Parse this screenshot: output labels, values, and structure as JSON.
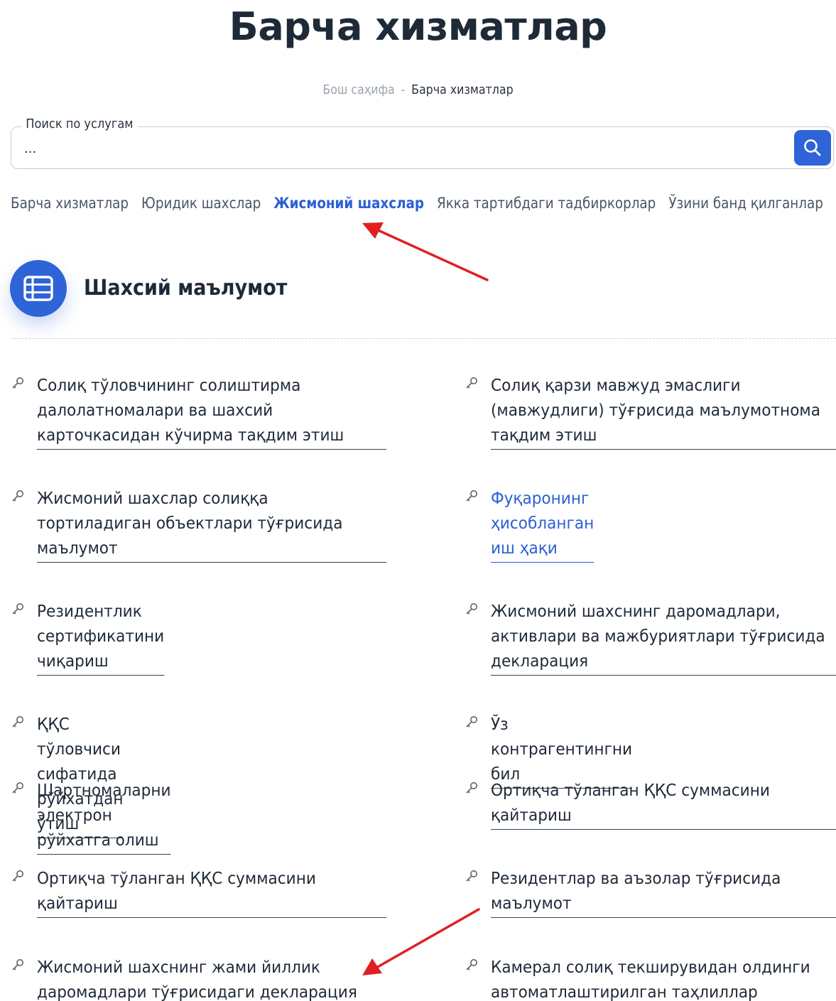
{
  "page": {
    "title": "Барча хизматлар"
  },
  "breadcrumb": {
    "home": "Бош саҳифа",
    "separator": "-",
    "current": "Барча хизматлар"
  },
  "search": {
    "label": "Поиск по услугам",
    "value": "",
    "placeholder": "...",
    "button_icon": "search-icon"
  },
  "tabs": [
    {
      "label": "Барча хизматлар",
      "active": false
    },
    {
      "label": "Юридик шахслар",
      "active": false
    },
    {
      "label": "Жисмоний шахслар",
      "active": true
    },
    {
      "label": "Якка тартибдаги тадбиркорлар",
      "active": false
    },
    {
      "label": "Ўзини банд қилганлар",
      "active": false
    }
  ],
  "section": {
    "icon": "list-icon",
    "title": "Шахсий маълумот"
  },
  "services": {
    "left": [
      {
        "label": "Солиқ тўловчининг солиштирма далолатномалари ва шахсий карточкасидан кўчирма тақдим этиш"
      },
      {
        "label": "Жисмоний шахслар солиққа тортиладиган объектлари тўғрисида маълумот"
      },
      {
        "label": "Резидентлик сертификатини чиқариш"
      },
      {
        "label": "ҚҚС тўловчиси сифатида рўйхатдан ўтиш"
      },
      {
        "label": "Шартномаларни электрон рўйхатга олиш"
      },
      {
        "label": "Ортиқча тўланган ҚҚС суммасини қайтариш"
      },
      {
        "label": "Жисмоний шахснинг жами йиллик даромадлари тўғрисидаги декларация"
      }
    ],
    "right": [
      {
        "label": "Солиқ қарзи мавжуд эмаслиги (мавжудлиги) тўғрисида маълумотнома тақдим этиш"
      },
      {
        "label": "Фуқаронинг ҳисобланган иш ҳақи",
        "highlight": true
      },
      {
        "label": "Жисмоний шахснинг даромадлари, активлари ва мажбуриятлари тўғрисида декларация"
      },
      {
        "label": "Ўз контрагентингни бил"
      },
      {
        "label": "Ортиқча тўланган ҚҚС суммасини қайтариш"
      },
      {
        "label": "Резидентлар ва аъзолар тўғрисида маълумот"
      },
      {
        "label": "Камерал солиқ текширувидан олдинги автоматлаштирилган таҳлиллар"
      }
    ],
    "item_icon": "key-icon"
  },
  "colors": {
    "accent": "#2f63d8",
    "active_tab": "#2b5fd4",
    "annotation_arrow": "#e02020"
  }
}
